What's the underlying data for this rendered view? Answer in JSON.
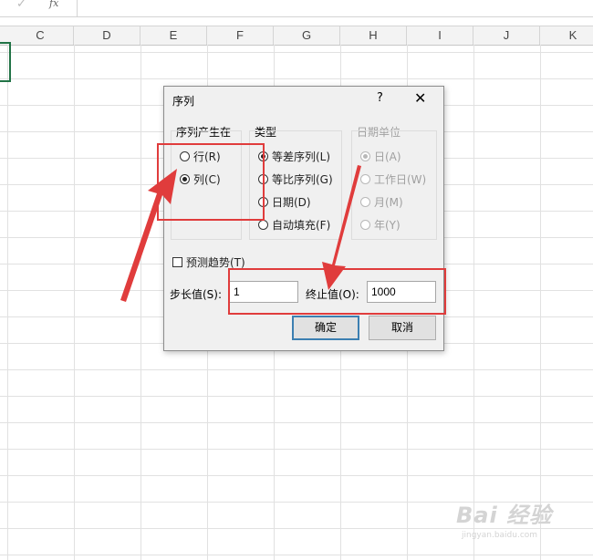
{
  "formula_bar": {
    "check_icon": "✓",
    "fx_label": "fx"
  },
  "columns": [
    "C",
    "D",
    "E",
    "F",
    "G",
    "H",
    "I",
    "J",
    "K"
  ],
  "dialog": {
    "title": "序列",
    "help_label": "?",
    "close_label": "✕",
    "series_in": {
      "title": "序列产生在",
      "options": [
        {
          "label": "行(R)",
          "checked": false
        },
        {
          "label": "列(C)",
          "checked": true
        }
      ]
    },
    "type": {
      "title": "类型",
      "options": [
        {
          "label": "等差序列(L)",
          "checked": true
        },
        {
          "label": "等比序列(G)",
          "checked": false
        },
        {
          "label": "日期(D)",
          "checked": false
        },
        {
          "label": "自动填充(F)",
          "checked": false
        }
      ]
    },
    "date_unit": {
      "title": "日期单位",
      "options": [
        {
          "label": "日(A)",
          "checked": true
        },
        {
          "label": "工作日(W)",
          "checked": false
        },
        {
          "label": "月(M)",
          "checked": false
        },
        {
          "label": "年(Y)",
          "checked": false
        }
      ]
    },
    "trend_label": "预测趋势(T)",
    "trend_checked": false,
    "step_label": "步长值(S):",
    "step_value": "1",
    "stop_label": "终止值(O):",
    "stop_value": "1000",
    "ok_label": "确定",
    "cancel_label": "取消"
  },
  "annotation_color": "#e03c3c",
  "watermark": {
    "brand": "Bai 经验",
    "url": "jingyan.baidu.com"
  }
}
